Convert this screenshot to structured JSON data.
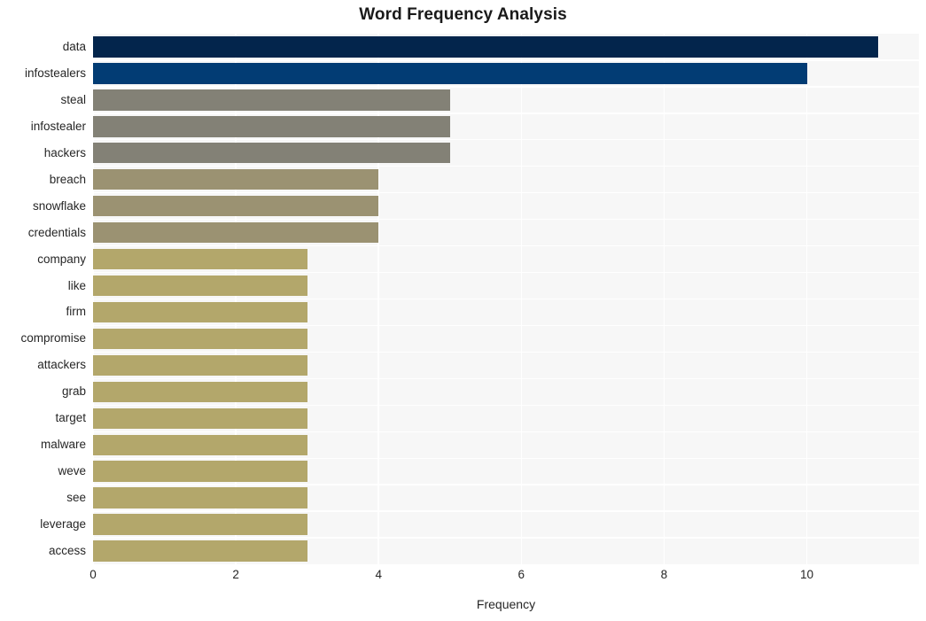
{
  "chart_data": {
    "type": "bar",
    "orientation": "horizontal",
    "title": "Word Frequency Analysis",
    "xlabel": "Frequency",
    "ylabel": "",
    "categories": [
      "data",
      "infostealers",
      "steal",
      "infostealer",
      "hackers",
      "breach",
      "snowflake",
      "credentials",
      "company",
      "like",
      "firm",
      "compromise",
      "attackers",
      "grab",
      "target",
      "malware",
      "weve",
      "see",
      "leverage",
      "access"
    ],
    "values": [
      11,
      10,
      5,
      5,
      5,
      4,
      4,
      4,
      3,
      3,
      3,
      3,
      3,
      3,
      3,
      3,
      3,
      3,
      3,
      3
    ],
    "bar_colors": [
      "#03254c",
      "#023c74",
      "#838176",
      "#838176",
      "#838176",
      "#9b9272",
      "#9b9272",
      "#9b9272",
      "#b3a76b",
      "#b3a76b",
      "#b3a76b",
      "#b3a76b",
      "#b3a76b",
      "#b3a76b",
      "#b3a76b",
      "#b3a76b",
      "#b3a76b",
      "#b3a76b",
      "#b3a76b",
      "#b3a76b"
    ],
    "xlim": [
      0,
      11.57
    ],
    "xticks": [
      0,
      2,
      4,
      6,
      8,
      10
    ],
    "xtick_labels": [
      "0",
      "2",
      "4",
      "6",
      "8",
      "10"
    ],
    "grid": "vertical-only",
    "legend": "none",
    "plot_background": "#f7f7f7",
    "gridline_color": "#ffffff",
    "figure_background": "#ffffff",
    "text_color": "#262626"
  }
}
